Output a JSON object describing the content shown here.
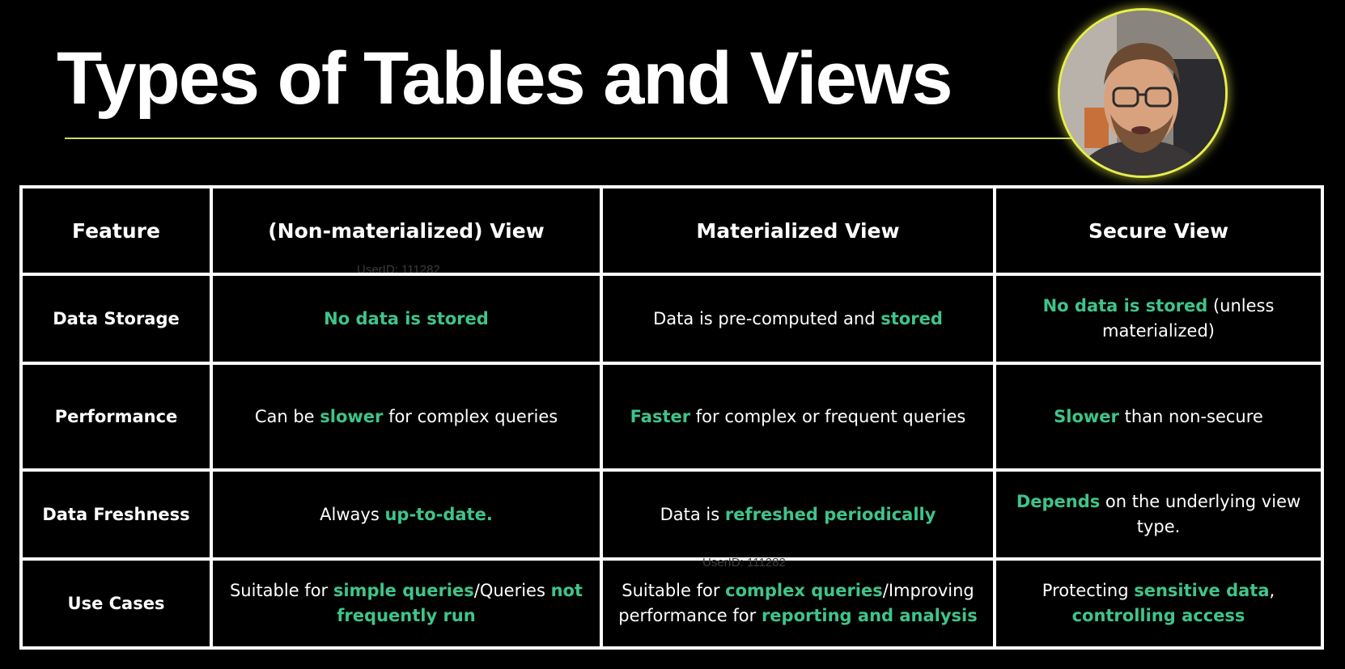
{
  "slide": {
    "title": "Types of Tables and Views"
  },
  "watermarks": [
    "UserID: 111282",
    "UserID: 111282"
  ],
  "colors": {
    "background": "#000000",
    "text": "#ffffff",
    "highlight": "#3fc48a",
    "title_rule": "#c9d96a",
    "avatar_ring": "#e7ee4a"
  },
  "table": {
    "headers": [
      "Feature",
      "(Non-materialized) View",
      "Materialized View",
      "Secure View"
    ],
    "rows": [
      {
        "feature": "Data Storage",
        "non_materialized": [
          {
            "text": "No data is stored",
            "highlight": true
          }
        ],
        "materialized": [
          {
            "text": "Data is pre-computed and ",
            "highlight": false
          },
          {
            "text": "stored",
            "highlight": true
          }
        ],
        "secure": [
          {
            "text": "No data is stored",
            "highlight": true
          },
          {
            "text": " (unless materialized)",
            "highlight": false
          }
        ]
      },
      {
        "feature": "Performance",
        "non_materialized": [
          {
            "text": "Can be ",
            "highlight": false
          },
          {
            "text": "slower",
            "highlight": true
          },
          {
            "text": " for complex queries",
            "highlight": false
          }
        ],
        "materialized": [
          {
            "text": "Faster",
            "highlight": true
          },
          {
            "text": " for complex or frequent queries",
            "highlight": false
          }
        ],
        "secure": [
          {
            "text": "Slower",
            "highlight": true
          },
          {
            "text": " than non-secure",
            "highlight": false
          }
        ]
      },
      {
        "feature": "Data Freshness",
        "non_materialized": [
          {
            "text": "Always ",
            "highlight": false
          },
          {
            "text": "up-to-date",
            "highlight": true
          },
          {
            "text": ".",
            "highlight": true
          }
        ],
        "materialized": [
          {
            "text": "Data is ",
            "highlight": false
          },
          {
            "text": "refreshed periodically",
            "highlight": true
          }
        ],
        "secure": [
          {
            "text": "Depends",
            "highlight": true
          },
          {
            "text": " on the underlying view type.",
            "highlight": false
          }
        ]
      },
      {
        "feature": "Use Cases",
        "non_materialized": [
          {
            "text": "Suitable for ",
            "highlight": false
          },
          {
            "text": "simple queries",
            "highlight": true
          },
          {
            "text": "/Queries ",
            "highlight": false
          },
          {
            "text": "not frequently run",
            "highlight": true
          }
        ],
        "materialized": [
          {
            "text": "Suitable for ",
            "highlight": false
          },
          {
            "text": "complex queries",
            "highlight": true
          },
          {
            "text": "/Improving performance for ",
            "highlight": false
          },
          {
            "text": "reporting and analysis",
            "highlight": true
          }
        ],
        "secure": [
          {
            "text": "Protecting ",
            "highlight": false
          },
          {
            "text": "sensitive data",
            "highlight": true
          },
          {
            "text": ", ",
            "highlight": false
          },
          {
            "text": "controlling access",
            "highlight": true
          }
        ]
      }
    ]
  }
}
